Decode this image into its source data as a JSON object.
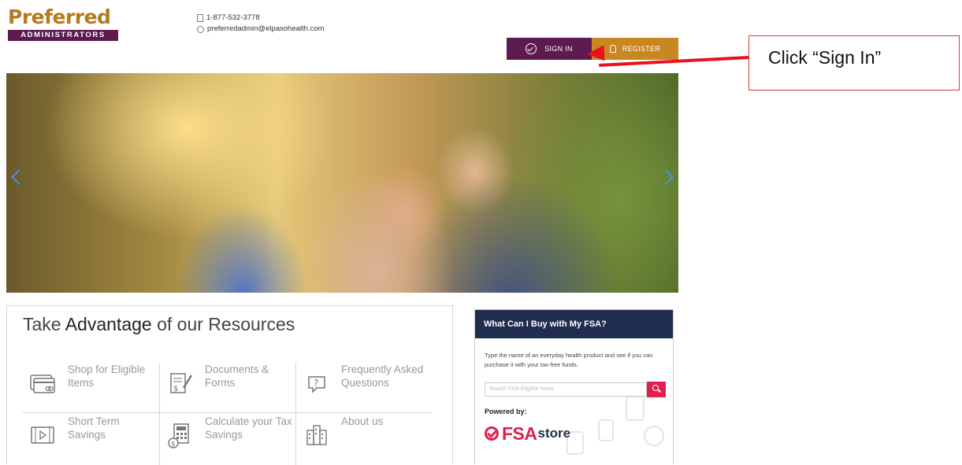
{
  "logo": {
    "word": "Preferred",
    "bar": "ADMINISTRATORS"
  },
  "contact": {
    "phone": "1-877-532-3778",
    "email": "preferredadmin@elpasohealth.com"
  },
  "header_buttons": {
    "sign_in": "SIGN IN",
    "register": "REGISTER"
  },
  "annotation": {
    "callout": "Click “Sign In”"
  },
  "resources": {
    "title_pre": "Take ",
    "title_bold": "Advantage",
    "title_post": " of our Resources",
    "items": [
      {
        "label": "Shop for Eligible Items"
      },
      {
        "label": "Documents & Forms"
      },
      {
        "label": "Frequently Asked Questions"
      },
      {
        "label": "Short Term Savings"
      },
      {
        "label": "Calculate your Tax Savings"
      },
      {
        "label": "About us"
      }
    ]
  },
  "fsa_widget": {
    "heading": "What Can I Buy with My FSA?",
    "description": "Type the name of an everyday health product and see if you can purchase it with your tax-free funds.",
    "search_placeholder": "Search FSA-Eligible Items",
    "powered_by": "Powered by:",
    "brand_fsa": "FSA",
    "brand_store": "store"
  },
  "colors": {
    "purple": "#5c1a4e",
    "gold": "#c98722",
    "navy": "#1f2d4e",
    "fsa_red": "#e01f4f",
    "annotation_red": "#e8111c"
  }
}
